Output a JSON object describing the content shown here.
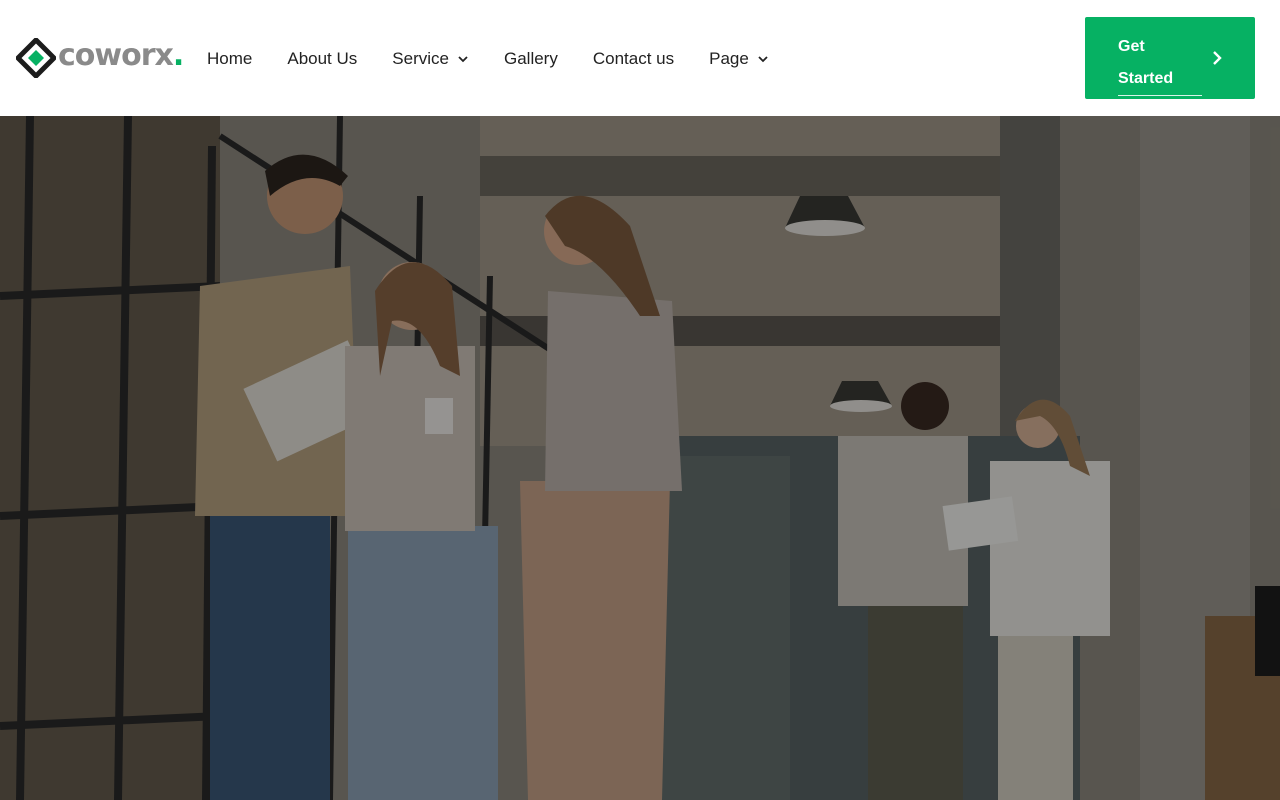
{
  "brand": {
    "name": "coworx",
    "dot": ".",
    "accent_color": "#06b163"
  },
  "nav": {
    "items": [
      {
        "label": "Home",
        "dropdown": false
      },
      {
        "label": "About Us",
        "dropdown": false
      },
      {
        "label": "Service",
        "dropdown": true,
        "icon": "chevron-down-icon"
      },
      {
        "label": "Gallery",
        "dropdown": false
      },
      {
        "label": "Contact us",
        "dropdown": false
      },
      {
        "label": "Page",
        "dropdown": true,
        "icon": "chevron-down-icon"
      }
    ]
  },
  "cta": {
    "label": "Get Started",
    "icon": "chevron-right-icon",
    "color": "#06b163"
  },
  "hero": {
    "image": "hero-photo"
  }
}
